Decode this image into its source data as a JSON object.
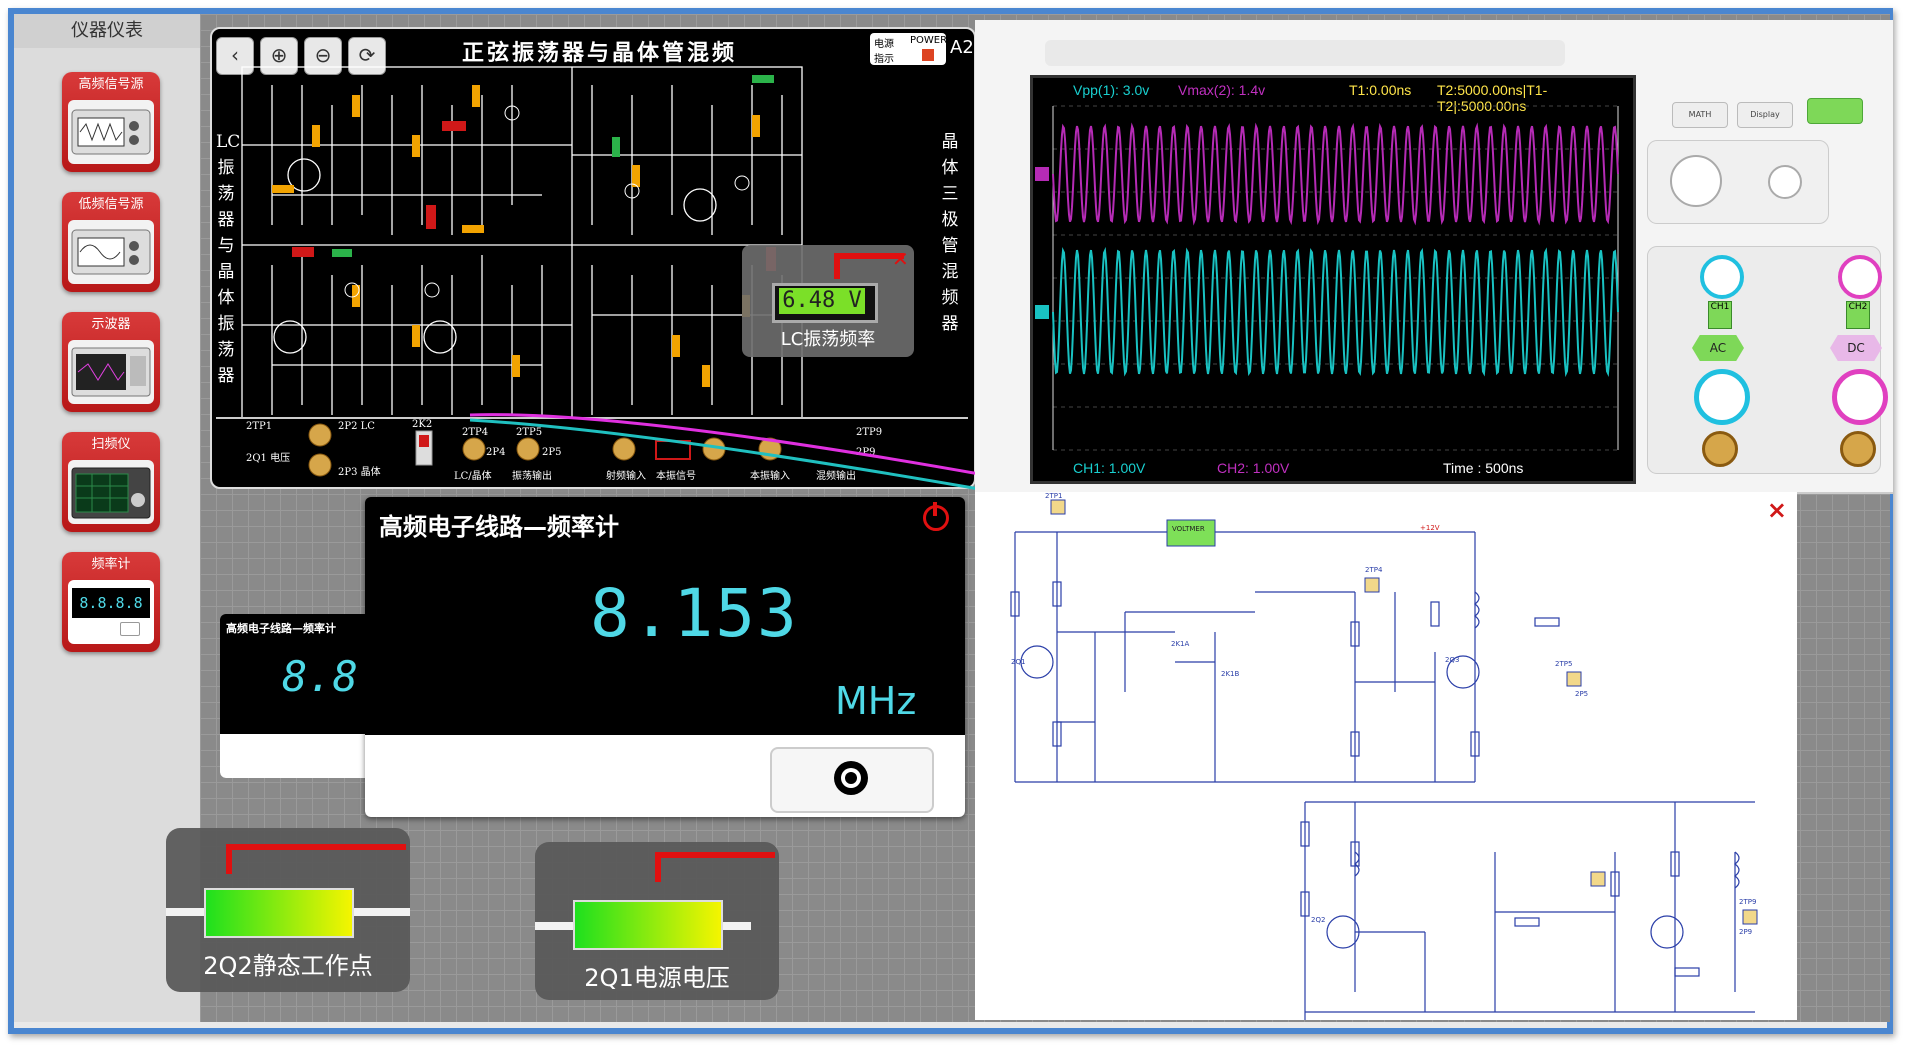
{
  "sidebar": {
    "title": "仪器仪表",
    "instruments": [
      {
        "label": "高频信号源"
      },
      {
        "label": "低频信号源"
      },
      {
        "label": "示波器"
      },
      {
        "label": "扫频仪"
      },
      {
        "label": "频率计"
      }
    ],
    "mini_counter_digits": "8.8.8.8"
  },
  "board": {
    "title": "正弦振荡器与晶体管混频",
    "left_vertical": "LC振荡器与晶体振荡器",
    "right_vertical": "晶体三极管混频器",
    "tools": [
      "zoom-in",
      "zoom-out",
      "refresh",
      "back"
    ],
    "power_label": "电源\n指示",
    "power_tag": "POWER",
    "slot_label": "A2",
    "voltmeter": {
      "value": "6.48 V",
      "label": "LC振荡频率"
    },
    "rail_labels": [
      "2TP1",
      "2Q1 电压",
      "2P2 LC",
      "2P3 晶体",
      "2K2",
      "2TP4",
      "2P4",
      "2TP5",
      "2P5",
      "LC/晶体",
      "振荡输出",
      "射频输入",
      "本振信号",
      "本振输入",
      "2TP9",
      "2P9",
      "混频输出"
    ]
  },
  "oscilloscope": {
    "header_vpp": "Vpp(1): 3.0v",
    "header_vmax": "Vmax(2): 1.4v",
    "header_t1": "T1:0.00ns",
    "header_t2": "T2:5000.00ns|T1-T2|:5000.00ns",
    "ch1": "CH1:  1.00V",
    "ch2": "CH2:  1.00V",
    "time": "Time : 500ns",
    "buttons": [
      "MATH",
      "Display"
    ],
    "ch1_coupling": "AC",
    "ch2_coupling": "DC",
    "colors": {
      "ch1": "#19c2c2",
      "ch2": "#b52bb5"
    }
  },
  "freq_counter": {
    "title": "高频电子线路—频率计",
    "small_title": "高频电子线路—频率计",
    "value": "8.153",
    "unit": "MHz",
    "small_value": "8.8."
  },
  "schematic": {
    "close": "×",
    "labels": [
      "2TP1",
      "VOLTMER",
      "+12V",
      "2Q1",
      "2Q2",
      "2Q3",
      "2K1A",
      "2K1B",
      "2TP4",
      "2TP5",
      "2P5",
      "2TP9",
      "2P9"
    ]
  },
  "probes": [
    {
      "label": "2Q2静态工作点"
    },
    {
      "label": "2Q1电源电压"
    }
  ]
}
